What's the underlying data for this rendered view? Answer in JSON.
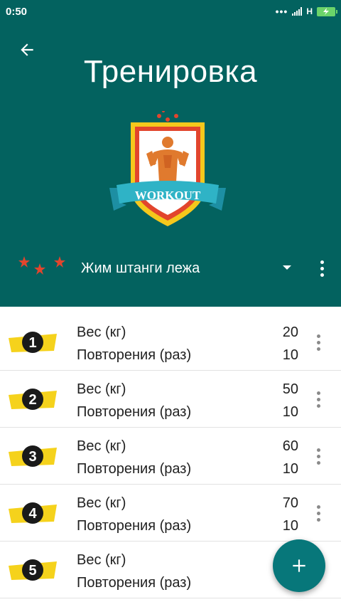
{
  "status_bar": {
    "time": "0:50",
    "network": "H",
    "icons": [
      "more-dots-icon",
      "signal-icon",
      "battery-charging-icon"
    ]
  },
  "header": {
    "title": "Тренировка",
    "logo_text": "WORKOUT",
    "exercise_name": "Жим штанги лежа",
    "background_color": "#03625F"
  },
  "sets": [
    {
      "number": "1",
      "weight_label": "Вес (кг)",
      "weight": "20",
      "reps_label": "Повторения (раз)",
      "reps": "10"
    },
    {
      "number": "2",
      "weight_label": "Вес (кг)",
      "weight": "50",
      "reps_label": "Повторения (раз)",
      "reps": "10"
    },
    {
      "number": "3",
      "weight_label": "Вес (кг)",
      "weight": "60",
      "reps_label": "Повторения (раз)",
      "reps": "10"
    },
    {
      "number": "4",
      "weight_label": "Вес (кг)",
      "weight": "70",
      "reps_label": "Повторения (раз)",
      "reps": "10"
    },
    {
      "number": "5",
      "weight_label": "Вес (кг)",
      "weight": "",
      "reps_label": "Повторения (раз)",
      "reps": ""
    }
  ],
  "colors": {
    "accent": "#07777A",
    "badge_yellow": "#F5D21C",
    "star_red": "#E2452D"
  }
}
